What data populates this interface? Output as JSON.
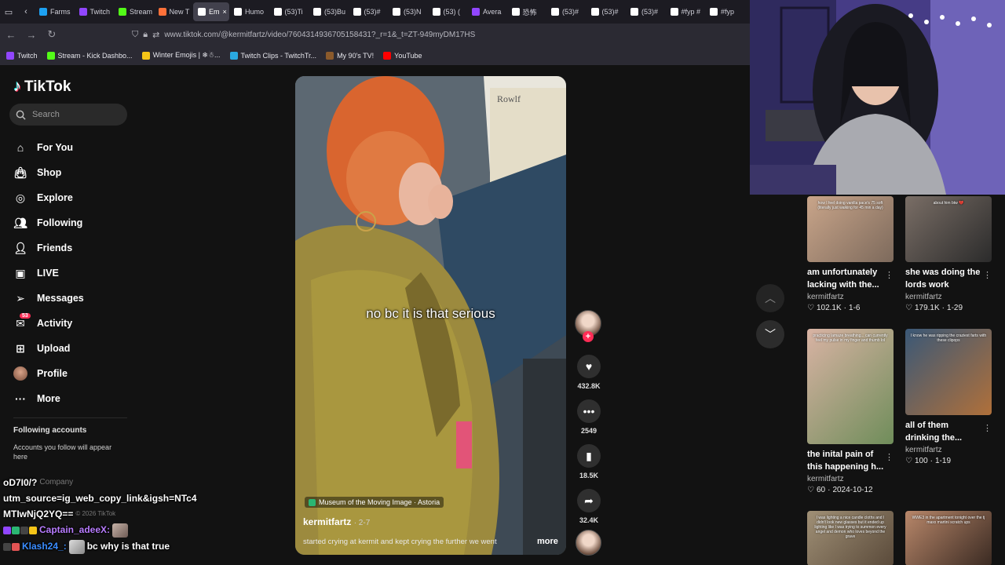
{
  "browser": {
    "tabs": [
      {
        "label": "Farms",
        "color": "#1da1f2"
      },
      {
        "label": "Twitch",
        "color": "#9146ff"
      },
      {
        "label": "Stream",
        "color": "#53fc18"
      },
      {
        "label": "New T",
        "color": "#ff7139"
      },
      {
        "label": "Em",
        "color": "#ffffff",
        "active": true
      },
      {
        "label": "Humo",
        "color": "#ffffff"
      },
      {
        "label": "(53)Ti",
        "color": "#ffffff"
      },
      {
        "label": "(53)Bu",
        "color": "#ffffff"
      },
      {
        "label": "(53)#",
        "color": "#ffffff"
      },
      {
        "label": "(53)N",
        "color": "#ffffff"
      },
      {
        "label": "(53) (",
        "color": "#ffffff"
      },
      {
        "label": "Avera",
        "color": "#9146ff"
      },
      {
        "label": "恐怖",
        "color": "#ffffff"
      },
      {
        "label": "(53)#",
        "color": "#ffffff"
      },
      {
        "label": "(53)#",
        "color": "#ffffff"
      },
      {
        "label": "(53)#",
        "color": "#ffffff"
      },
      {
        "label": "#fyp #",
        "color": "#ffffff"
      },
      {
        "label": "#fyp",
        "color": "#ffffff"
      }
    ],
    "url": "www.tiktok.com/@kermitfartz/video/7604314936705158431?_r=1&_t=ZT-949myDM17HS",
    "bookmarks": [
      {
        "label": "Twitch",
        "color": "#9146ff"
      },
      {
        "label": "Stream - Kick Dashbo...",
        "color": "#53fc18"
      },
      {
        "label": "Winter Emojis | ❄☃...",
        "color": "#f5c518"
      },
      {
        "label": "Twitch Clips - TwitchTr...",
        "color": "#2aa9e0"
      },
      {
        "label": "My 90's TV!",
        "color": "#8b5a2b"
      },
      {
        "label": "YouTube",
        "color": "#ff0000"
      }
    ]
  },
  "tiktok": {
    "logo": "TikTok",
    "search_placeholder": "Search",
    "nav": [
      {
        "label": "For You",
        "icon": "home-icon"
      },
      {
        "label": "Shop",
        "icon": "shop-bag-icon"
      },
      {
        "label": "Explore",
        "icon": "compass-icon"
      },
      {
        "label": "Following",
        "icon": "following-icon"
      },
      {
        "label": "Friends",
        "icon": "friends-icon"
      },
      {
        "label": "LIVE",
        "icon": "live-icon"
      },
      {
        "label": "Messages",
        "icon": "send-icon"
      },
      {
        "label": "Activity",
        "icon": "activity-icon",
        "badge": "53"
      },
      {
        "label": "Upload",
        "icon": "upload-icon"
      },
      {
        "label": "Profile",
        "icon": "avatar"
      },
      {
        "label": "More",
        "icon": "more-icon"
      }
    ],
    "following_title": "Following accounts",
    "following_text": "Accounts you follow will appear here",
    "copyright_ghost": "© 2026 TikTok",
    "company_ghost": "Company"
  },
  "video": {
    "overlay_caption": "no bc it is that serious",
    "location": "Museum of the Moving Image · Astoria",
    "author": "kermitfartz",
    "date": "· 2-7",
    "description": "started crying at kermit and kept crying the further we went",
    "more": "more",
    "wall_sign": "Rowlf",
    "likes": "432.8K",
    "comments": "2549",
    "saves": "18.5K",
    "shares": "32.4K"
  },
  "recommended": [
    {
      "title": "am unfortunately lacking with the...",
      "author": "kermitfartz",
      "likes": "102.1K",
      "date": "1-6",
      "thumb_text": "how I feel doing vanilla pace's 75 soft (literally just walking for 45 min a day)"
    },
    {
      "title": "she was doing the lords work",
      "author": "kermitfartz",
      "likes": "179.1K",
      "date": "1-29",
      "thumb_text": "about him btw 💔"
    },
    {
      "title": "the inital pain of this happening h...",
      "author": "kermitfartz",
      "likes": "60",
      "date": "2024-10-12",
      "thumb_text": "practicing lamaze breathing... can currently feel my pulse in my finger and thumb lol"
    },
    {
      "title": "all of them drinking the...",
      "author": "kermitfartz",
      "likes": "100",
      "date": "1-19",
      "thumb_text": "I know he was ripping the craziest farts with these clipops"
    },
    {
      "title": "",
      "author": "",
      "likes": "",
      "date": "",
      "thumb_text": "I was lighting a nice candle cloths and I didn't look new glasses but it ended up lighting like I was trying to summon every angel and demon who loves beyond the grave"
    },
    {
      "title": "",
      "author": "",
      "likes": "",
      "date": "",
      "thumb_text": "WWE3 in the apartment tonight over the tj maxx martini scratch ups"
    }
  ],
  "chat": {
    "line1": "oD7I0/?",
    "line2": "utm_source=ig_web_copy_link&igsh=NTc4",
    "line3": "MTIwNjQ2YQ==",
    "user1": "Captain_adeeX:",
    "user2": "Klash24_:",
    "msg2": "bc why is that true"
  }
}
